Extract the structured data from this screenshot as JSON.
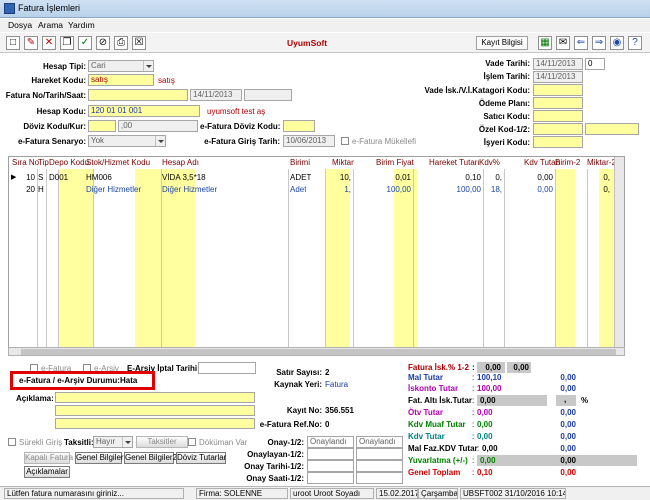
{
  "window": {
    "title": "Fatura İşlemleri"
  },
  "menu": [
    "Dosya",
    "Arama",
    "Yardım"
  ],
  "toolbar": {
    "brand": "UyumSoft",
    "kayit_bilgisi": "Kayıt Bilgisi"
  },
  "form": {
    "hesap_tipi_label": "Hesap Tipi:",
    "hesap_tipi": "Cari",
    "hareket_kodu_label": "Hareket Kodu:",
    "hareket_kodu": "satış",
    "hareket_kodu_desc": "satış",
    "fatura_no_label": "Fatura No/Tarih/Saat:",
    "fatura_tarih": "14/11/2013",
    "hesap_kodu_label": "Hesap Kodu:",
    "hesap_kodu": "120 01 01 001",
    "hesap_adi": "uyumsoft test aş",
    "doviz_label": "Döviz Kodu/Kur:",
    "doviz_kur": ",00",
    "efatura_doviz_label": "e-Fatura Döviz Kodu:",
    "efatura_senaryo_label": "e-Fatura Senaryo:",
    "efatura_senaryo": "Yok",
    "efatura_giris_label": "e-Fatura Giriş Tarih:",
    "efatura_giris": "10/06/2013",
    "efatura_mukellefi": "e-Fatura Mükellefi",
    "vade_tarihi_label": "Vade Tarihi:",
    "vade_tarihi": "14/11/2013",
    "vade_gun": "0",
    "islem_tarihi_label": "İşlem Tarihi:",
    "islem_tarihi": "14/11/2013",
    "vade_isk_label": "Vade İsk./V.İ.Katagori Kodu:",
    "odeme_plani_label": "Ödeme Planı:",
    "satici_kodu_label": "Satıcı Kodu:",
    "ozel_kod_label": "Özel Kod-1/2:",
    "isyeri_kodu_label": "İşyeri Kodu:"
  },
  "grid": {
    "headers": [
      "Sıra No",
      "Tip",
      "Depo Kodu",
      "Stok/Hizmet Kodu",
      "Hesap Adı",
      "Birimi",
      "Miktar",
      "Birim Fiyat",
      "Hareket Tutarı",
      "Kdv%",
      "Kdv Tutarı",
      "Birim-2",
      "Miktar-2"
    ],
    "rows": [
      {
        "sira": "10",
        "tip": "S",
        "depo": "D001",
        "stok": "HM006",
        "ad": "VİDA 3,5*18",
        "birim": "ADET",
        "miktar": "10,",
        "fiyat": "0,01",
        "tutar": "0,10",
        "kdv": "0,",
        "kdv_tutar": "0,00",
        "miktar2": "0,"
      },
      {
        "sira": "20",
        "tip": "H",
        "depo": "",
        "stok": "Diğer Hizmetler",
        "ad": "Diğer Hizmetler",
        "birim": "Adet",
        "miktar": "1,",
        "fiyat": "100,00",
        "tutar": "100,00",
        "kdv": "18,",
        "kdv_tutar": "0,00",
        "miktar2": "0,"
      }
    ]
  },
  "bottom": {
    "efatura_chk": "e-Fatura",
    "earsiv_chk": "e-Arşiv",
    "earsiv_iptal": "E-Arşiv İptal Tarihi:",
    "durum_label": "e-Fatura / e-Arşiv Durumu:",
    "durum_value": "Hata",
    "aciklama_label": "Açıklama:",
    "surekli_giris": "Sürekli Giriş",
    "taksitli_label": "Taksitli:",
    "taksitli_value": "Hayır",
    "taksitler_btn": "Taksitler",
    "dokuman_var": "Döküman Var",
    "kapali_fatura_btn": "Kapalı Fatura",
    "genel_bilgiler_btn": "Genel Bilgiler",
    "genel_bilgiler2_btn": "Genel Bilgiler2",
    "doviz_tutarlar_btn": "Döviz Tutarlar",
    "aciklamalar_btn": "Açıklamalar",
    "satir_sayisi_label": "Satır Sayısı:",
    "satir_sayisi": "2",
    "kaynak_yeri_label": "Kaynak Yeri:",
    "kaynak_yeri": "Fatura",
    "kayit_no_label": "Kayıt No:",
    "kayit_no": "356.551",
    "efatura_refno_label": "e-Fatura Ref.No:",
    "efatura_refno": "0",
    "onay1_label": "Onay-1/2:",
    "onay2_label": "Onaylayan-1/2:",
    "onay3_label": "Onay Tarihi-1/2:",
    "onay4_label": "Onay Saati-1/2:",
    "onaylandi1": "Onaylandı",
    "onaylandi2": "Onaylandı"
  },
  "totals": [
    {
      "label": "Fatura İsk.% 1-2",
      "color": "#b00000",
      "v1": "0,00",
      "v2": "0,00"
    },
    {
      "label": "Mal Tutar",
      "color": "#1a3aa8",
      "v1": "100,10",
      "v2": "0,00"
    },
    {
      "label": "İskonto Tutar",
      "color": "#b000b0",
      "v1": "100,00",
      "v2": "0,00"
    },
    {
      "label": "Fat. Altı İsk.Tutar",
      "color": "#000000",
      "v1": "0,00",
      "v2": "%"
    },
    {
      "label": "Ötv Tutar",
      "color": "#b000b0",
      "v1": "0,00",
      "v2": "0,00"
    },
    {
      "label": "Kdv Muaf Tutar",
      "color": "#008000",
      "v1": "0,00",
      "v2": "0,00"
    },
    {
      "label": "Kdv Tutar",
      "color": "#008080",
      "v1": "0,00",
      "v2": "0,00"
    },
    {
      "label": "Mal Faz.KDV Tutar",
      "color": "#000000",
      "v1": "0,00",
      "v2": "0,00"
    },
    {
      "label": "Yuvarlatma (+/-)",
      "color": "#008000",
      "v1": "0,00",
      "v2": "0,00"
    },
    {
      "label": "Genel Toplam",
      "color": "#d00000",
      "v1": "0,10",
      "v2": "0,00"
    }
  ],
  "statusbar": [
    "Lütfen fatura numarasını giriniz...",
    "Firma: SOLENNE",
    "uroot Uroot Soyadı",
    "15.02.2017",
    "Çarşamba",
    "UBSFT002 31/10/2016 10:14"
  ]
}
